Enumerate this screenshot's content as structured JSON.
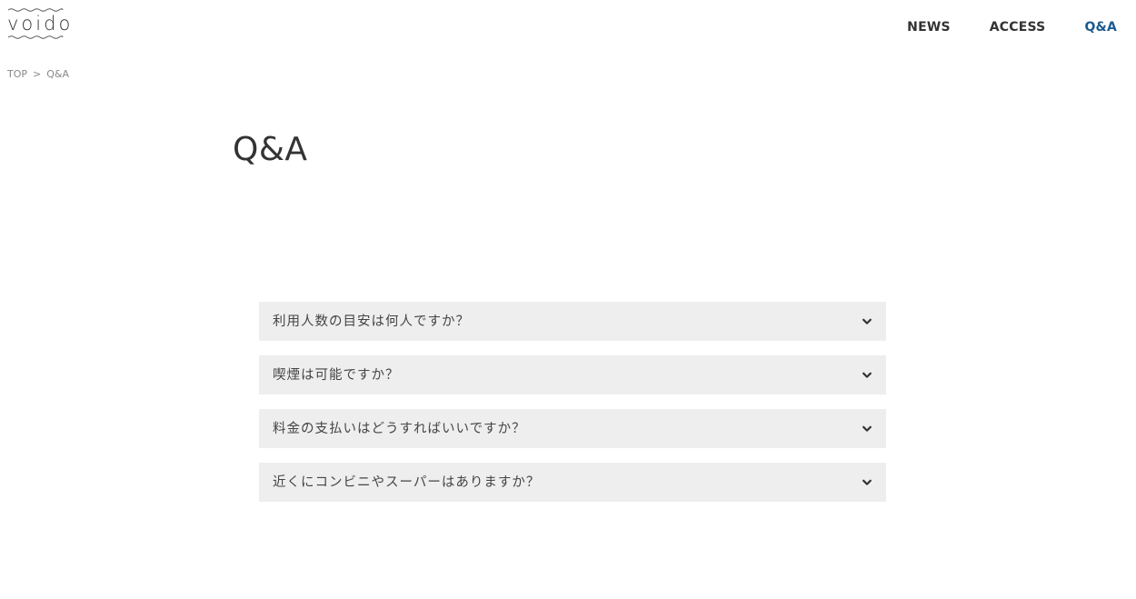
{
  "header": {
    "logo_text": "voido",
    "nav": [
      {
        "label": "NEWS"
      },
      {
        "label": "ACCESS"
      },
      {
        "label": "Q&A"
      }
    ],
    "accent_color": "#1c5a8e"
  },
  "breadcrumb": {
    "items": [
      "TOP",
      "Q&A"
    ],
    "separator": ">"
  },
  "page_title": "Q&A",
  "faq": {
    "items": [
      {
        "question": "利用人数の目安は何人ですか？",
        "icon": "chevron-down-icon"
      },
      {
        "question": "喫煙は可能ですか？",
        "icon": "chevron-down-icon"
      },
      {
        "question": "料金の支払いはどうすればいいですか？",
        "icon": "chevron-down-icon"
      },
      {
        "question": "近くにコンビニやスーパーはありますか？",
        "icon": "chevron-down-icon"
      }
    ]
  }
}
